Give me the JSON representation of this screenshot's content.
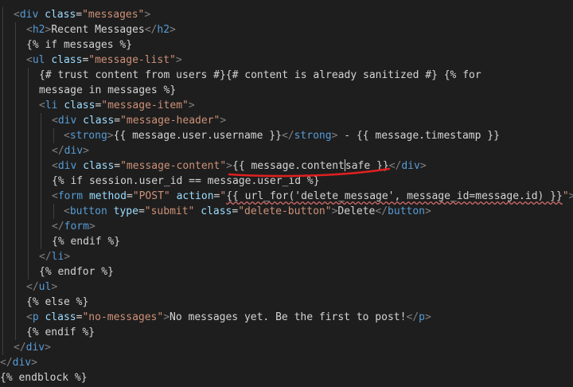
{
  "editor": {
    "lines": [
      {
        "segments": [
          [
            "t",
            "<"
          ],
          [
            "n",
            "div"
          ],
          [
            "x",
            " "
          ],
          [
            "a",
            "class"
          ],
          [
            "x",
            "="
          ],
          [
            "s",
            "\"messages\""
          ],
          [
            "t",
            ">"
          ]
        ]
      },
      {
        "segments": [
          [
            "t",
            "<"
          ],
          [
            "n",
            "h2"
          ],
          [
            "t",
            ">"
          ],
          [
            "x",
            "Recent Messages"
          ],
          [
            "t",
            "</"
          ],
          [
            "n",
            "h2"
          ],
          [
            "t",
            ">"
          ]
        ]
      },
      {
        "segments": [
          [
            "x",
            "{% if messages %}"
          ]
        ]
      },
      {
        "segments": [
          [
            "t",
            "<"
          ],
          [
            "n",
            "ul"
          ],
          [
            "x",
            " "
          ],
          [
            "a",
            "class"
          ],
          [
            "x",
            "="
          ],
          [
            "s",
            "\"message-list\""
          ],
          [
            "t",
            ">"
          ]
        ]
      },
      {
        "segments": [
          [
            "x",
            "{# trust content from users #}{# content is already sanitized #} {% for"
          ]
        ]
      },
      {
        "segments": [
          [
            "x",
            "message in messages %}"
          ]
        ]
      },
      {
        "segments": [
          [
            "t",
            "<"
          ],
          [
            "n",
            "li"
          ],
          [
            "x",
            " "
          ],
          [
            "a",
            "class"
          ],
          [
            "x",
            "="
          ],
          [
            "s",
            "\"message-item\""
          ],
          [
            "t",
            ">"
          ]
        ]
      },
      {
        "segments": [
          [
            "t",
            "<"
          ],
          [
            "n",
            "div"
          ],
          [
            "x",
            " "
          ],
          [
            "a",
            "class"
          ],
          [
            "x",
            "="
          ],
          [
            "s",
            "\"message-header\""
          ],
          [
            "t",
            ">"
          ]
        ]
      },
      {
        "segments": [
          [
            "t",
            "<"
          ],
          [
            "n",
            "strong"
          ],
          [
            "t",
            ">"
          ],
          [
            "x",
            "{{ message.user.username }}"
          ],
          [
            "t",
            "</"
          ],
          [
            "n",
            "strong"
          ],
          [
            "t",
            ">"
          ],
          [
            "x",
            " - {{ message.timestamp }}"
          ]
        ]
      },
      {
        "segments": [
          [
            "t",
            "</"
          ],
          [
            "n",
            "div"
          ],
          [
            "t",
            ">"
          ]
        ]
      },
      {
        "segments": [
          [
            "t",
            "<"
          ],
          [
            "n",
            "div"
          ],
          [
            "x",
            " "
          ],
          [
            "a",
            "class"
          ],
          [
            "x",
            "="
          ],
          [
            "s",
            "\"message-content\""
          ],
          [
            "t",
            ">"
          ],
          [
            "x",
            "{{ message.content"
          ],
          [
            "cur",
            ""
          ],
          [
            "x",
            "safe }}"
          ],
          [
            "t",
            "</"
          ],
          [
            "n",
            "div"
          ],
          [
            "t",
            ">"
          ]
        ]
      },
      {
        "segments": [
          [
            "x",
            "{% if session.user_id == message.user_id %}"
          ]
        ]
      },
      {
        "segments": [
          [
            "t",
            "<"
          ],
          [
            "n",
            "form"
          ],
          [
            "x",
            " "
          ],
          [
            "a",
            "method"
          ],
          [
            "x",
            "="
          ],
          [
            "s",
            "\"POST\""
          ],
          [
            "x",
            " "
          ],
          [
            "a",
            "action"
          ],
          [
            "x",
            "="
          ],
          [
            "s",
            "\""
          ],
          [
            "sq",
            "{{ url_for('delete_message', message_id=message.id) }}"
          ],
          [
            "s",
            "\""
          ],
          [
            "t",
            ">"
          ]
        ]
      },
      {
        "segments": [
          [
            "t",
            "<"
          ],
          [
            "n",
            "button"
          ],
          [
            "x",
            " "
          ],
          [
            "a",
            "type"
          ],
          [
            "x",
            "="
          ],
          [
            "s",
            "\"submit\""
          ],
          [
            "x",
            " "
          ],
          [
            "a",
            "class"
          ],
          [
            "x",
            "="
          ],
          [
            "s",
            "\"delete-button\""
          ],
          [
            "t",
            ">"
          ],
          [
            "x",
            "Delete"
          ],
          [
            "t",
            "</"
          ],
          [
            "n",
            "button"
          ],
          [
            "t",
            ">"
          ]
        ]
      },
      {
        "segments": [
          [
            "t",
            "</"
          ],
          [
            "n",
            "form"
          ],
          [
            "t",
            ">"
          ]
        ]
      },
      {
        "segments": [
          [
            "x",
            "{% endif %}"
          ]
        ]
      },
      {
        "segments": [
          [
            "t",
            "</"
          ],
          [
            "n",
            "li"
          ],
          [
            "t",
            ">"
          ]
        ]
      },
      {
        "segments": [
          [
            "x",
            "{% endfor %}"
          ]
        ]
      },
      {
        "segments": [
          [
            "t",
            "</"
          ],
          [
            "n",
            "ul"
          ],
          [
            "t",
            ">"
          ]
        ]
      },
      {
        "segments": [
          [
            "x",
            "{% else %}"
          ]
        ]
      },
      {
        "segments": [
          [
            "t",
            "<"
          ],
          [
            "n",
            "p"
          ],
          [
            "x",
            " "
          ],
          [
            "a",
            "class"
          ],
          [
            "x",
            "="
          ],
          [
            "s",
            "\"no-messages\""
          ],
          [
            "t",
            ">"
          ],
          [
            "x",
            "No messages yet. Be the first to post!"
          ],
          [
            "t",
            "</"
          ],
          [
            "n",
            "p"
          ],
          [
            "t",
            ">"
          ]
        ]
      },
      {
        "segments": [
          [
            "x",
            "{% endif %}"
          ]
        ]
      },
      {
        "segments": [
          [
            "t",
            "</"
          ],
          [
            "n",
            "div"
          ],
          [
            "t",
            ">"
          ]
        ]
      },
      {
        "segments": [
          [
            "t",
            "</"
          ],
          [
            "n",
            "div"
          ],
          [
            "t",
            ">"
          ]
        ]
      },
      {
        "segments": [
          [
            "x",
            "{% endblock %}"
          ]
        ]
      }
    ]
  },
  "colors": {
    "background": "#1e1e1e",
    "tag_bracket": "#808080",
    "tag_name": "#569cd6",
    "attribute": "#9cdcfe",
    "string": "#ce9178",
    "text": "#d4d4d4",
    "annotation_underline": "#e02020"
  }
}
